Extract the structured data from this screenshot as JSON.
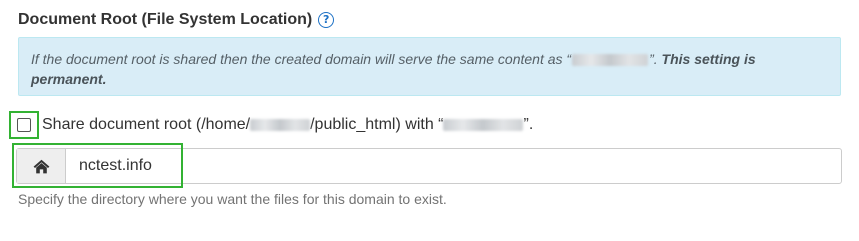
{
  "section": {
    "title": "Document Root (File System Location)",
    "help_icon": "question-circle-icon",
    "help_glyph": "?"
  },
  "info": {
    "text_before": "If the document root is shared then the created domain will serve the same content as “",
    "text_after": "”.",
    "strong_text": "This setting is permanent."
  },
  "share": {
    "label_prefix": "Share document root (/home/",
    "label_middle": "/public_html) with “",
    "label_suffix": "”."
  },
  "document_root": {
    "addon_icon": "home-icon",
    "value": "nctest.info",
    "help": "Specify the directory where you want the files for this domain to exist."
  },
  "colors": {
    "highlight": "#33b233",
    "info_bg": "#d9edf7",
    "help_icon": "#1d71c5"
  }
}
